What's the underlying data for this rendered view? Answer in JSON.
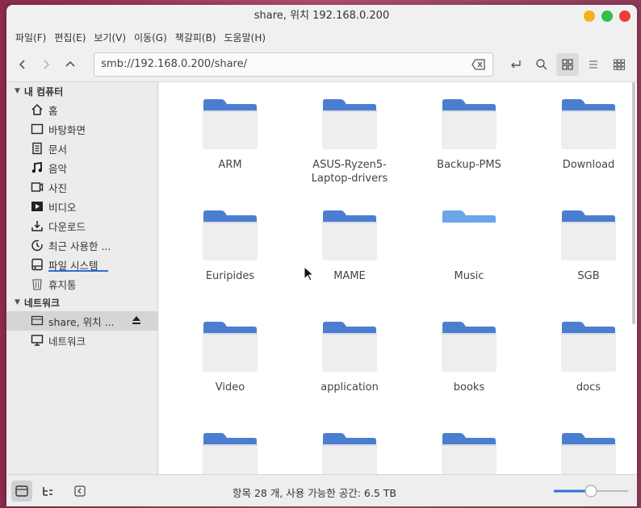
{
  "window": {
    "title": "share, 위치 192.168.0.200"
  },
  "menu": [
    "파일(F)",
    "편집(E)",
    "보기(V)",
    "이동(G)",
    "책갈피(B)",
    "도움말(H)"
  ],
  "location": {
    "path": "smb://192.168.0.200/share/"
  },
  "sidebar": {
    "computer_header": "내 컴퓨터",
    "computer_items": [
      {
        "label": "홈",
        "icon": "home-icon"
      },
      {
        "label": "바탕화면",
        "icon": "desktop-icon"
      },
      {
        "label": "문서",
        "icon": "documents-icon"
      },
      {
        "label": "음악",
        "icon": "music-icon"
      },
      {
        "label": "사진",
        "icon": "pictures-icon"
      },
      {
        "label": "비디오",
        "icon": "video-icon"
      },
      {
        "label": "다운로드",
        "icon": "downloads-icon"
      },
      {
        "label": "최근 사용한 ...",
        "icon": "recent-icon"
      },
      {
        "label": "파일 시스템",
        "icon": "filesystem-icon"
      },
      {
        "label": "휴지통",
        "icon": "trash-icon"
      }
    ],
    "network_header": "네트워크",
    "network_items": [
      {
        "label": "share, 위치 ...",
        "icon": "network-share-icon"
      },
      {
        "label": "네트워크",
        "icon": "network-icon"
      }
    ]
  },
  "files": [
    {
      "name": "ARM",
      "name2": ""
    },
    {
      "name": "ASUS-Ryzen5-",
      "name2": "Laptop-drivers"
    },
    {
      "name": "Backup-PMS",
      "name2": ""
    },
    {
      "name": "Download",
      "name2": ""
    },
    {
      "name": "Euripides",
      "name2": ""
    },
    {
      "name": "MAME",
      "name2": ""
    },
    {
      "name": "Music",
      "name2": ""
    },
    {
      "name": "SGB",
      "name2": ""
    },
    {
      "name": "Video",
      "name2": ""
    },
    {
      "name": "application",
      "name2": ""
    },
    {
      "name": "books",
      "name2": ""
    },
    {
      "name": "docs",
      "name2": ""
    },
    {
      "name": "",
      "name2": ""
    },
    {
      "name": "",
      "name2": ""
    },
    {
      "name": "",
      "name2": ""
    },
    {
      "name": "",
      "name2": ""
    }
  ],
  "status": {
    "text": "항목 28 개, 사용 가능한 공간: 6.5 TB",
    "zoom_level": 0.5
  },
  "colors": {
    "folder_tab": "#4a7fd0",
    "folder_body": "#eeeef1",
    "accent": "#2f6fd6",
    "close": "#ef3b3b",
    "maximize": "#2fbf4a",
    "minimize": "#f2b21e"
  }
}
